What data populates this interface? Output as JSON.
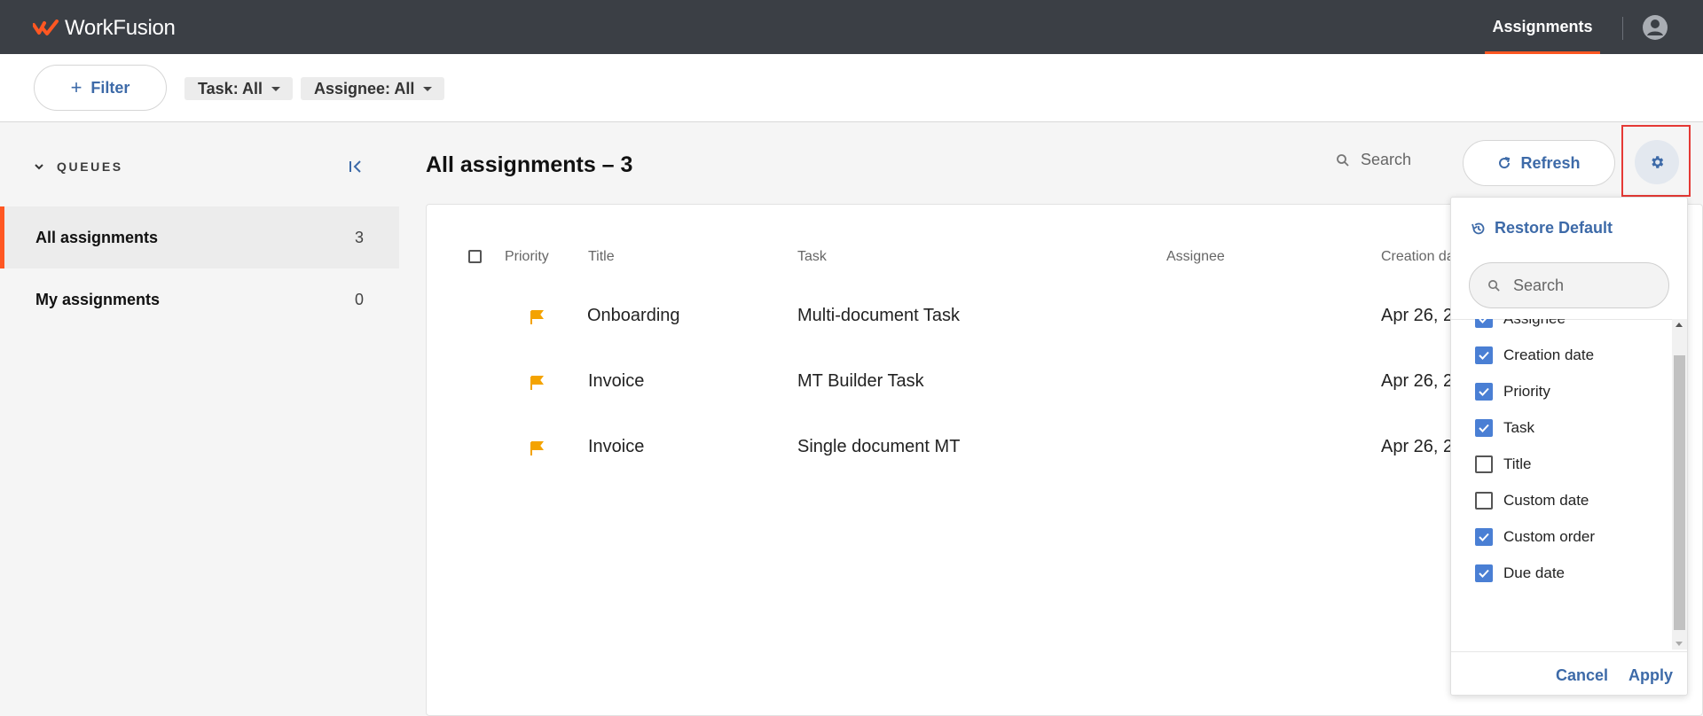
{
  "app": {
    "brand": "WorkFusion",
    "nav_tab": "Assignments"
  },
  "colors": {
    "topbar": "#3b3f45",
    "accent": "#ff5722",
    "link": "#3d6aa8",
    "checkbox": "#4a7fd4",
    "flag": "#f4a300"
  },
  "filterbar": {
    "filter_label": "Filter",
    "task_chip": "Task: All",
    "assignee_chip": "Assignee: All"
  },
  "sidebar": {
    "heading": "QUEUES",
    "items": [
      {
        "label": "All assignments",
        "count": "3",
        "active": true
      },
      {
        "label": "My assignments",
        "count": "0",
        "active": false
      }
    ]
  },
  "main": {
    "title": "All assignments – 3",
    "search_placeholder": "Search",
    "refresh_label": "Refresh",
    "columns": [
      "Priority",
      "Title",
      "Task",
      "Assignee",
      "Creation da"
    ],
    "rows": [
      {
        "title": "Onboarding",
        "task": "Multi-document Task",
        "assignee": "",
        "creation": "Apr 26, 2"
      },
      {
        "title": "Invoice",
        "task": "MT Builder Task",
        "assignee": "",
        "creation": "Apr 26, 2"
      },
      {
        "title": "Invoice",
        "task": "Single document MT",
        "assignee": "",
        "creation": "Apr 26, 2"
      }
    ]
  },
  "column_panel": {
    "restore_label": "Restore Default",
    "search_placeholder": "Search",
    "options": [
      {
        "label": "Assignee",
        "checked": true
      },
      {
        "label": "Creation date",
        "checked": true
      },
      {
        "label": "Priority",
        "checked": true
      },
      {
        "label": "Task",
        "checked": true
      },
      {
        "label": "Title",
        "checked": false
      },
      {
        "label": "Custom date",
        "checked": false
      },
      {
        "label": "Custom order",
        "checked": true
      },
      {
        "label": "Due date",
        "checked": true
      }
    ],
    "cancel_label": "Cancel",
    "apply_label": "Apply"
  }
}
